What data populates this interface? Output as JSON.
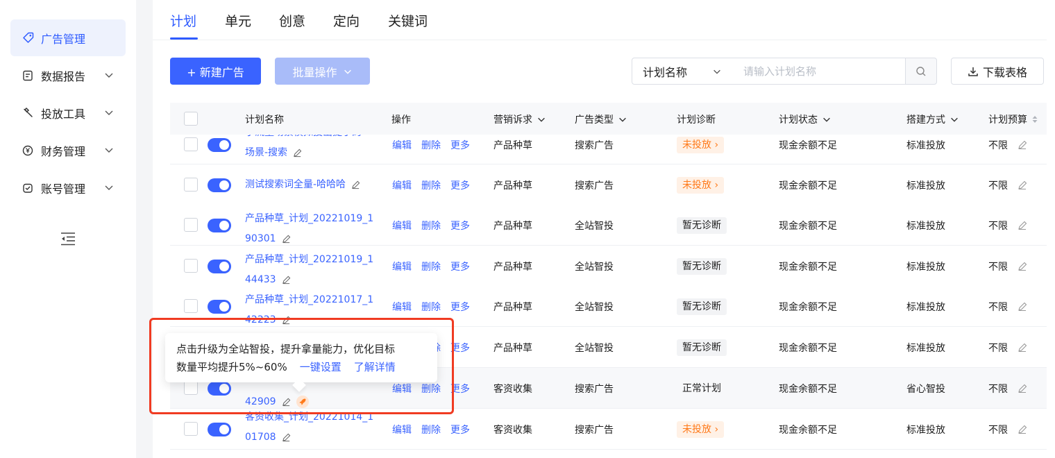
{
  "sidebar": {
    "items": [
      {
        "label": "广告管理",
        "icon": "tag-icon",
        "active": true
      },
      {
        "label": "数据报告",
        "icon": "report-icon",
        "active": false
      },
      {
        "label": "投放工具",
        "icon": "tool-icon",
        "active": false
      },
      {
        "label": "财务管理",
        "icon": "yen-icon",
        "active": false
      },
      {
        "label": "账号管理",
        "icon": "account-icon",
        "active": false
      }
    ],
    "collapse_icon": "collapse-icon"
  },
  "tabs": [
    {
      "label": "计划",
      "active": true
    },
    {
      "label": "单元"
    },
    {
      "label": "创意"
    },
    {
      "label": "定向"
    },
    {
      "label": "关键词"
    }
  ],
  "toolbar": {
    "new_label": "+ 新建广告",
    "batch_label": "批量操作",
    "filter_select": "计划名称",
    "search_placeholder": "请输入计划名称",
    "download_label": "下载表格"
  },
  "table": {
    "headers": {
      "name": "计划名称",
      "ops": "操作",
      "marketing": "营销诉求",
      "adtype": "广告类型",
      "diagnosis": "计划诊断",
      "status": "计划状态",
      "build": "搭建方式",
      "budget": "计划预算"
    },
    "op_labels": {
      "edit": "编辑",
      "delete": "删除",
      "more": "更多"
    },
    "rows": [
      {
        "name_line1": "小流量场景模拟投出提了的",
        "name_line2": "场景-搜索",
        "marketing": "产品种草",
        "adtype": "搜索广告",
        "diagnosis": "未投放 ›",
        "status": "现金余额不足",
        "build": "标准投放",
        "budget": "不限"
      },
      {
        "name_line1": "测试搜索词全量-哈哈哈",
        "name_line2": "",
        "marketing": "产品种草",
        "adtype": "搜索广告",
        "diagnosis": "未投放 ›",
        "status": "现金余额不足",
        "build": "标准投放",
        "budget": "不限"
      },
      {
        "name_line1": "产品种草_计划_20221019_1",
        "name_line2": "90301",
        "marketing": "产品种草",
        "adtype": "全站智投",
        "diagnosis": "暂无诊断",
        "status": "现金余额不足",
        "build": "标准投放",
        "budget": "不限"
      },
      {
        "name_line1": "产品种草_计划_20221019_1",
        "name_line2": "44433",
        "marketing": "产品种草",
        "adtype": "全站智投",
        "diagnosis": "暂无诊断",
        "status": "现金余额不足",
        "build": "标准投放",
        "budget": "不限"
      },
      {
        "name_line1": "产品种草_计划_20221017_1",
        "name_line2": "42223",
        "marketing": "产品种草",
        "adtype": "全站智投",
        "diagnosis": "暂无诊断",
        "status": "现金余额不足",
        "build": "标准投放",
        "budget": "不限"
      },
      {
        "name_line1": "",
        "name_line2": "",
        "marketing": "产品种草",
        "adtype": "全站智投",
        "diagnosis": "暂无诊断",
        "status": "现金余额不足",
        "build": "标准投放",
        "budget": "不限"
      },
      {
        "name_line1": "",
        "name_line2": "42909",
        "marketing": "客资收集",
        "adtype": "搜索广告",
        "diagnosis": "正常计划",
        "status": "现金余额不足",
        "build": "省心智投",
        "budget": "不限"
      },
      {
        "name_line1": "客资收集_计划_20221014_1",
        "name_line2": "01708",
        "marketing": "客资收集",
        "adtype": "搜索广告",
        "diagnosis": "未投放 ›",
        "status": "现金余额不足",
        "build": "标准投放",
        "budget": "不限"
      }
    ]
  },
  "tooltip": {
    "line1": "点击升级为全站智投，提升拿量能力，优化目标",
    "line2": "数量平均提升5%~60%",
    "link1": "一键设置",
    "link2": "了解详情"
  },
  "colors": {
    "primary": "#3a63ff",
    "warning": "#ff7a1a",
    "highlight": "#f03b22"
  }
}
